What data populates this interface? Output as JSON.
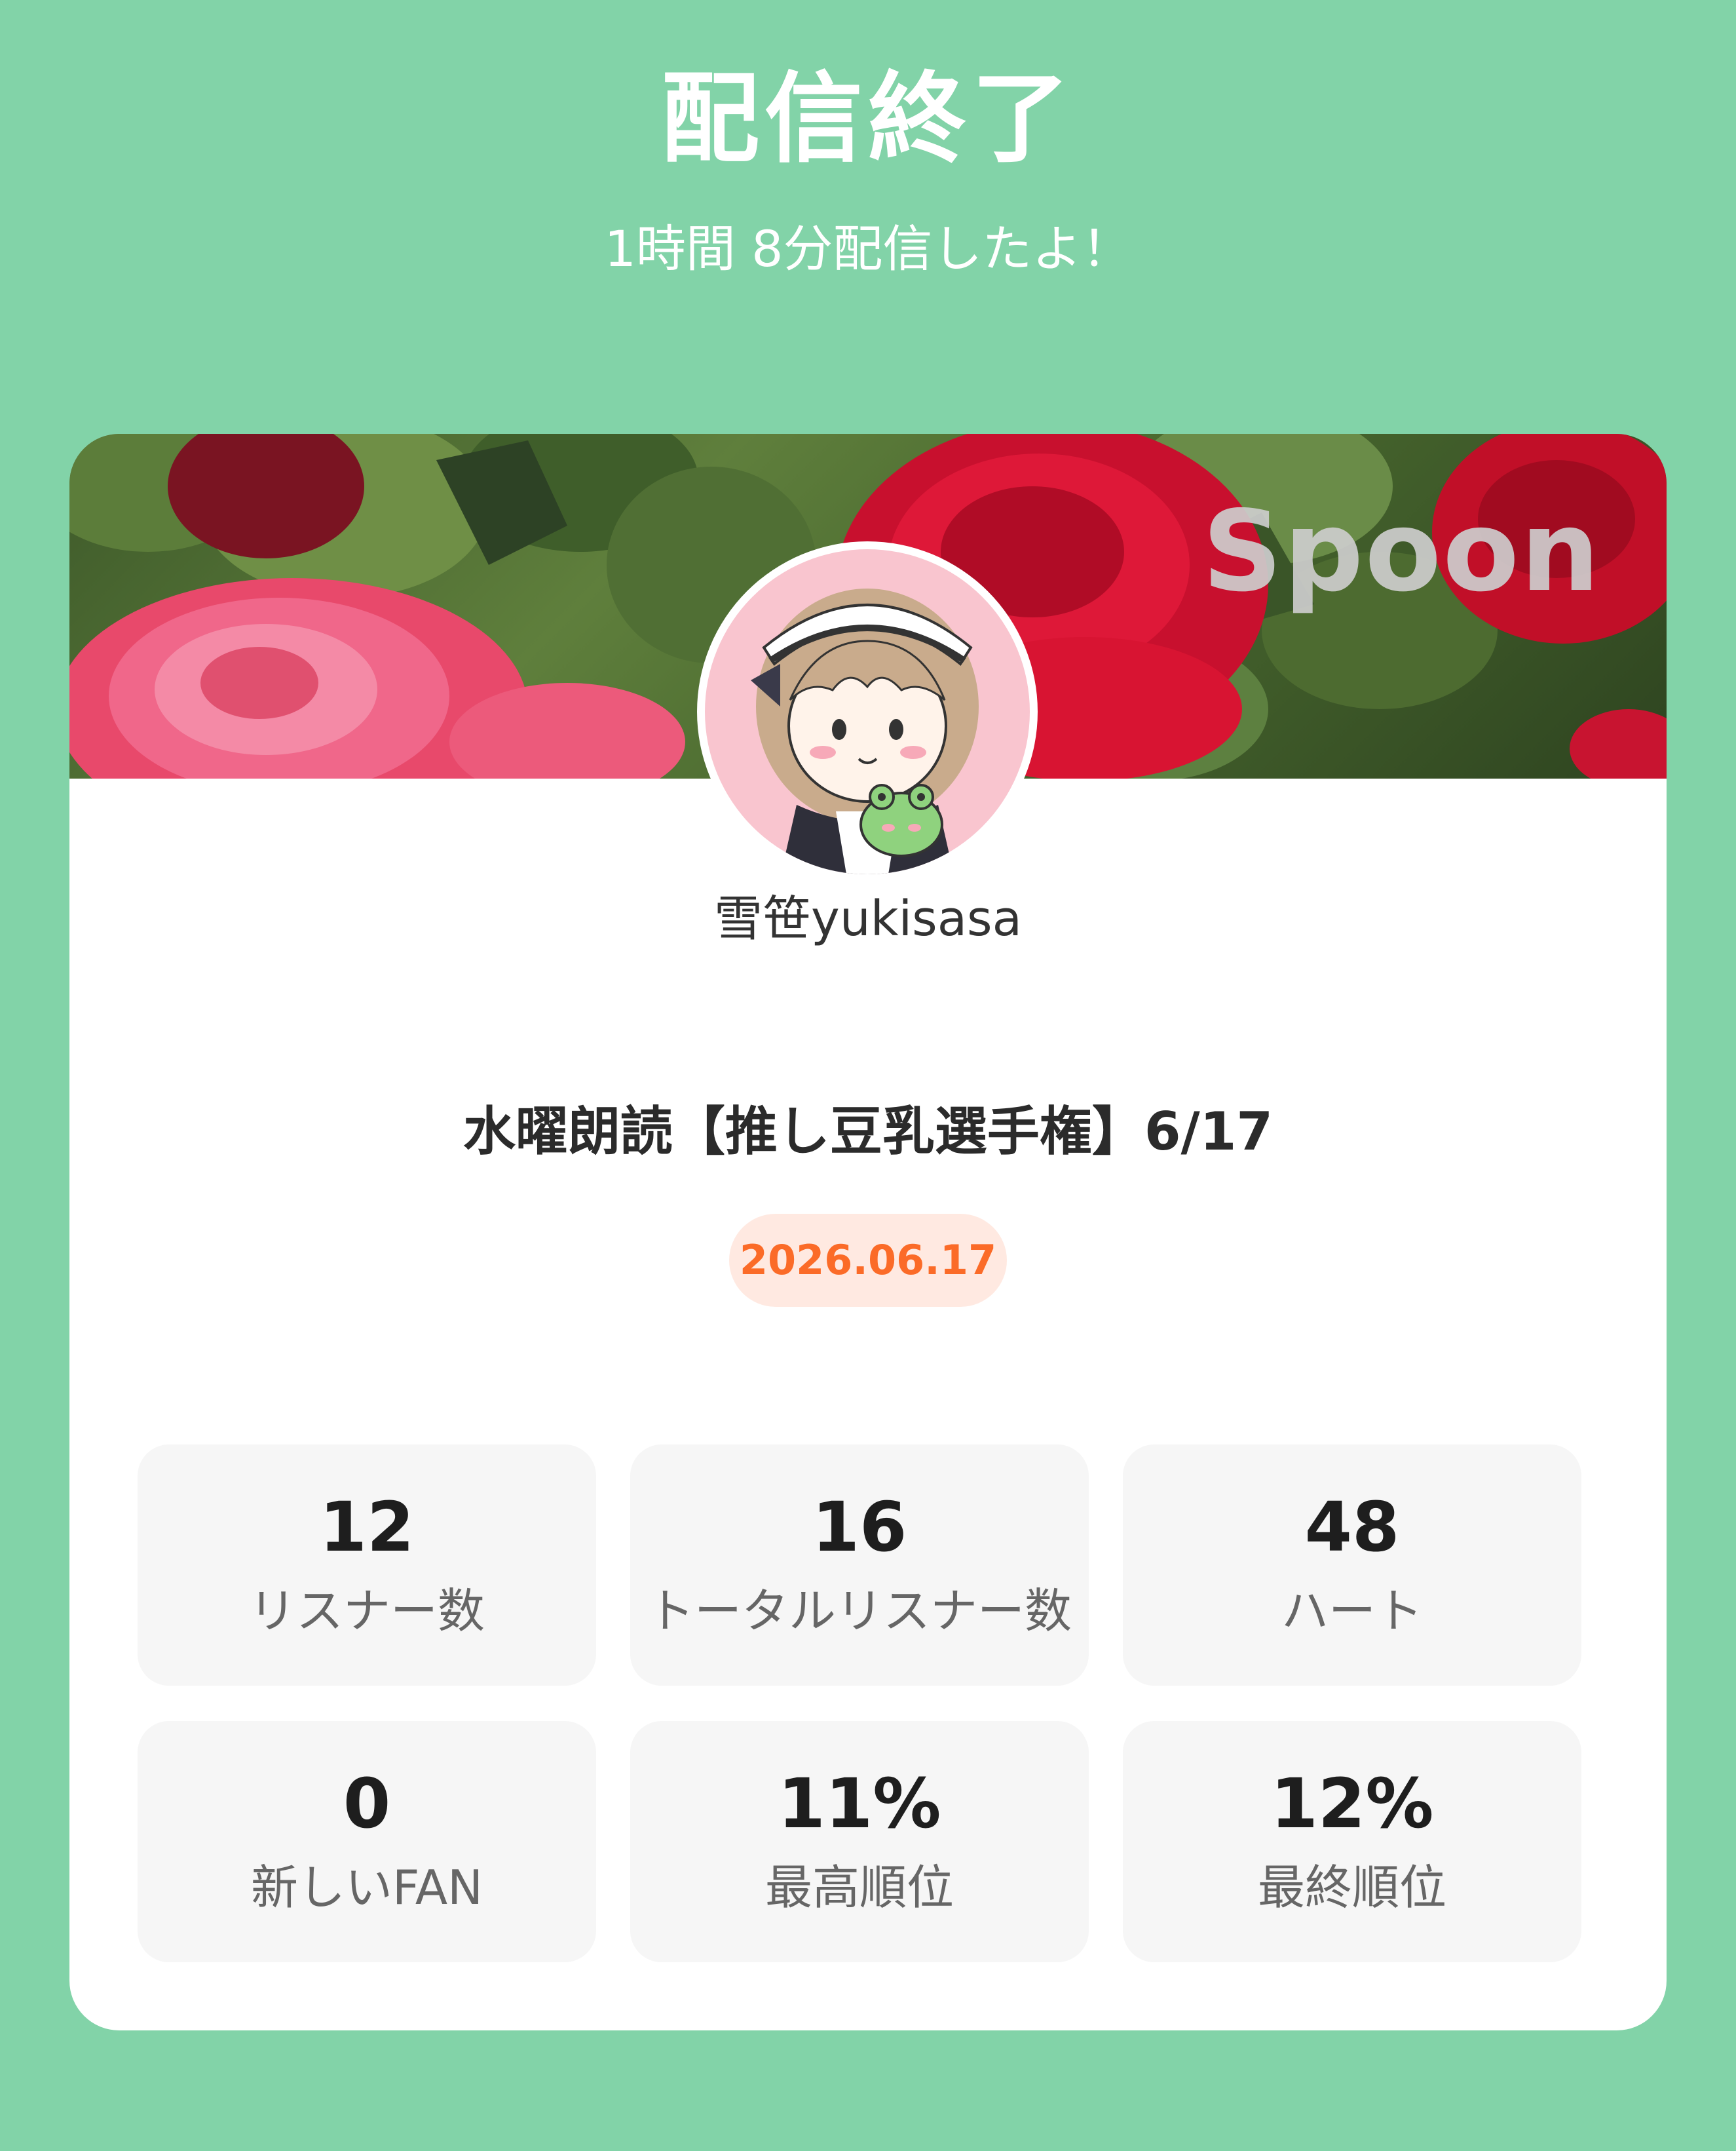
{
  "header": {
    "title": "配信終了",
    "subtitle": "1時間 8分配信したよ！"
  },
  "card": {
    "brand_logo": "Spoon",
    "username": "雪笹yukisasa",
    "broadcast_title": "水曜朗読【推し豆乳選手権】6/17",
    "date": "2026.06.17"
  },
  "stats": [
    {
      "value": "12",
      "label": "リスナー数"
    },
    {
      "value": "16",
      "label": "トータルリスナー数"
    },
    {
      "value": "48",
      "label": "ハート"
    },
    {
      "value": "0",
      "label": "新しいFAN"
    },
    {
      "value": "11%",
      "label": "最高順位"
    },
    {
      "value": "12%",
      "label": "最終順位"
    }
  ],
  "colors": {
    "background": "#82d3a8",
    "card": "#ffffff",
    "date_badge_bg": "#ffe9e1",
    "date_badge_text": "#fb6b28",
    "tile_bg": "#f6f6f6"
  },
  "icons": {
    "avatar": "maid-girl-with-frog-avatar",
    "banner": "roses-banner-image"
  }
}
